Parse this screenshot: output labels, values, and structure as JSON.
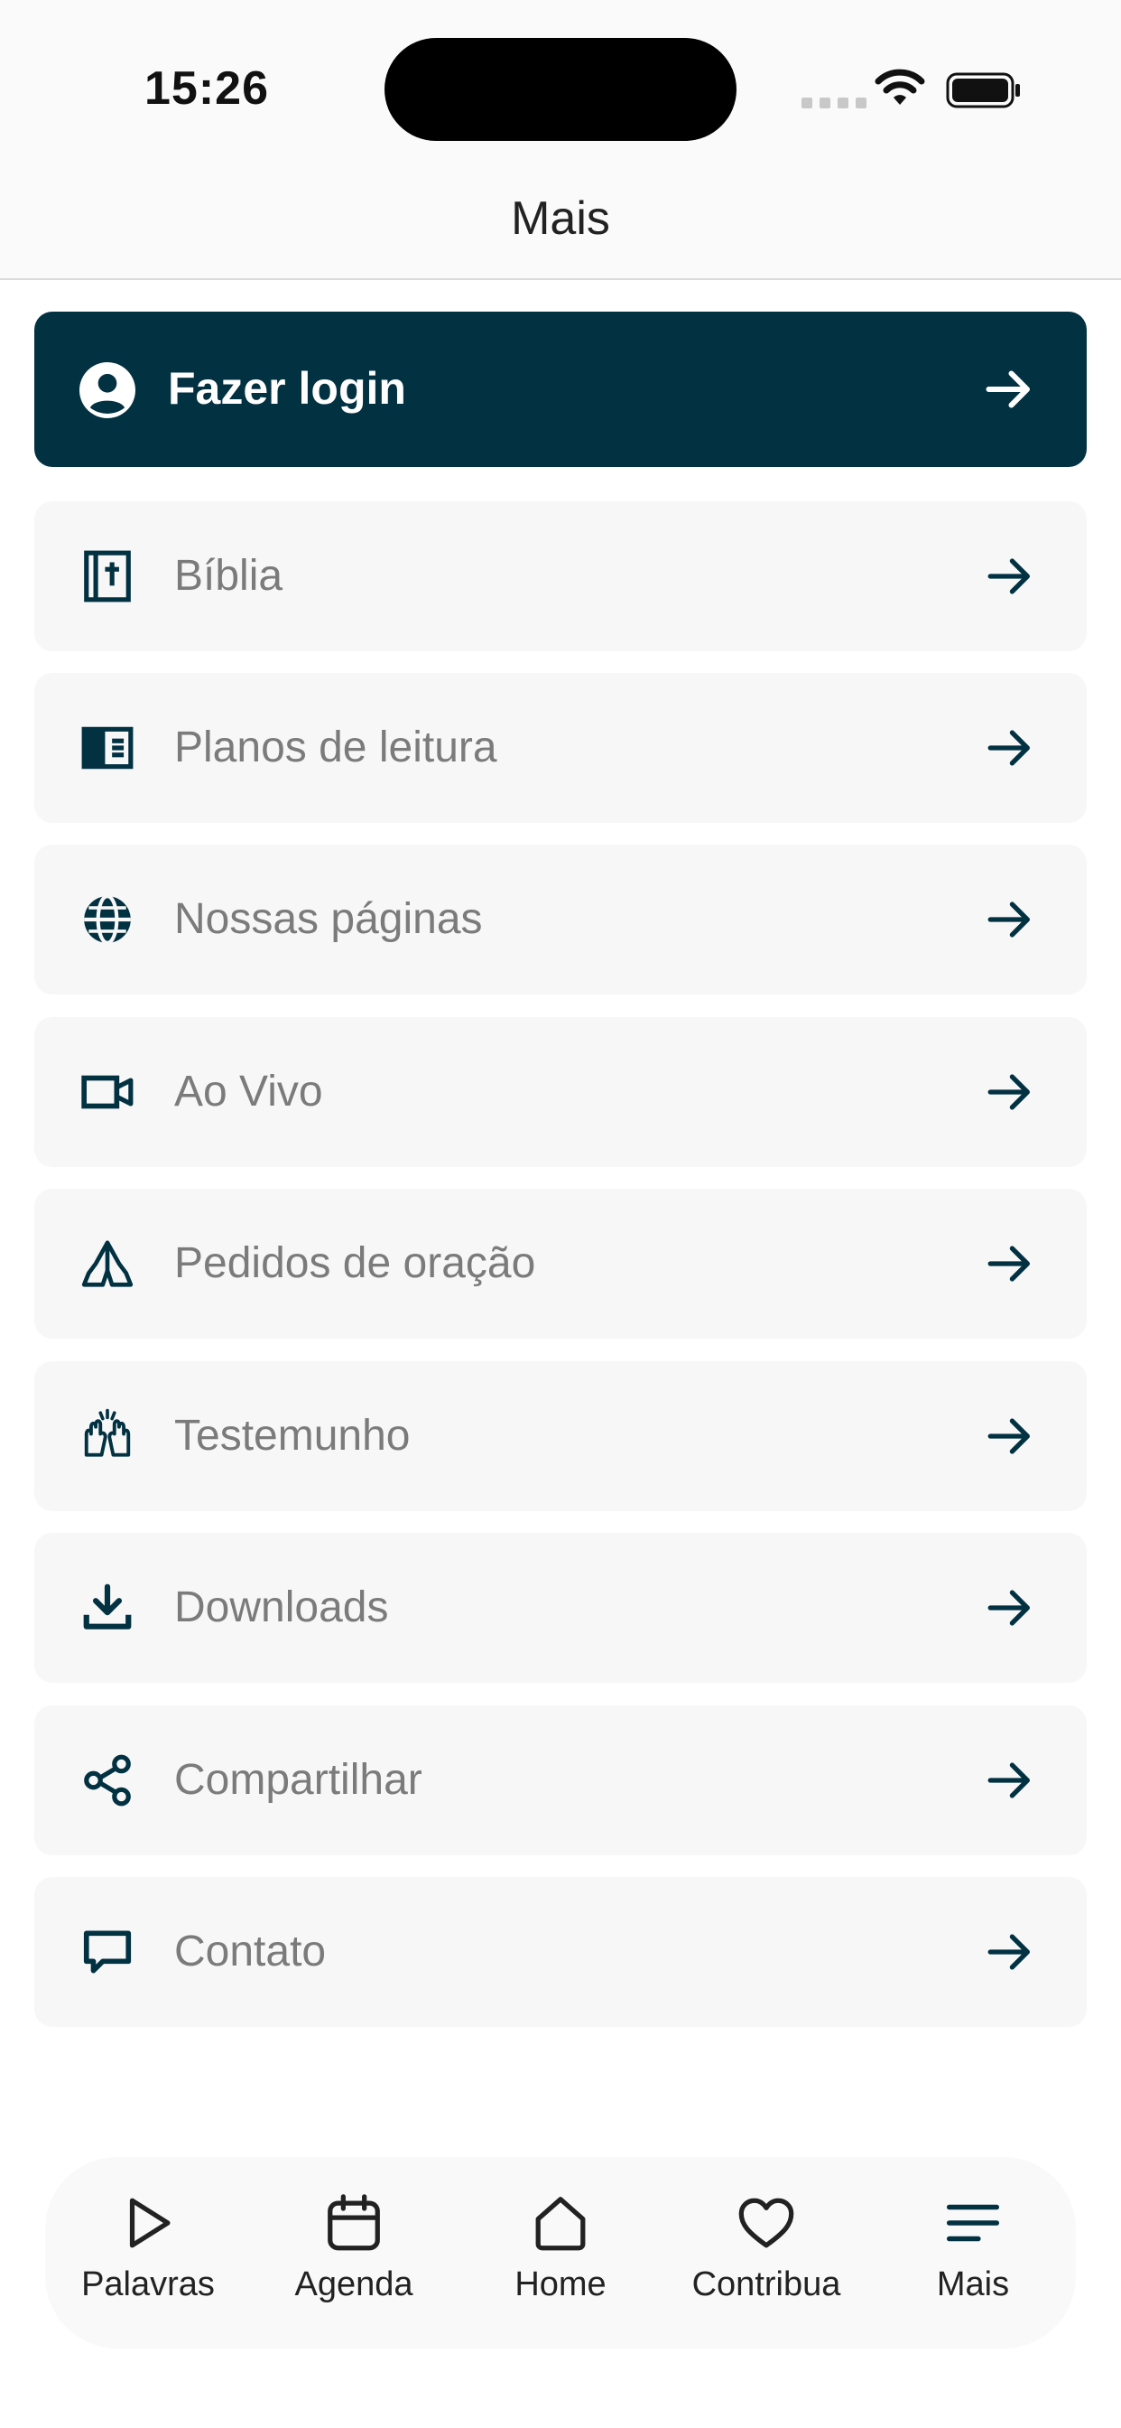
{
  "status_bar": {
    "time": "15:26"
  },
  "header": {
    "title": "Mais"
  },
  "login": {
    "label": "Fazer login"
  },
  "menu": [
    {
      "label": "Bíblia",
      "icon": "bible-icon"
    },
    {
      "label": "Planos de leitura",
      "icon": "reading-plan-icon"
    },
    {
      "label": "Nossas páginas",
      "icon": "globe-icon"
    },
    {
      "label": "Ao Vivo",
      "icon": "video-camera-icon"
    },
    {
      "label": "Pedidos de oração",
      "icon": "praying-hands-icon"
    },
    {
      "label": "Testemunho",
      "icon": "raised-hands-icon"
    },
    {
      "label": "Downloads",
      "icon": "download-icon"
    },
    {
      "label": "Compartilhar",
      "icon": "share-icon"
    },
    {
      "label": "Contato",
      "icon": "chat-icon"
    }
  ],
  "bottom_nav": [
    {
      "label": "Palavras",
      "icon": "play-icon"
    },
    {
      "label": "Agenda",
      "icon": "calendar-icon"
    },
    {
      "label": "Home",
      "icon": "home-icon"
    },
    {
      "label": "Contribua",
      "icon": "heart-icon"
    },
    {
      "label": "Mais",
      "icon": "menu-icon"
    }
  ],
  "colors": {
    "primary": "#023142",
    "item_bg": "#f7f7f7",
    "label": "#7b7b7b"
  }
}
